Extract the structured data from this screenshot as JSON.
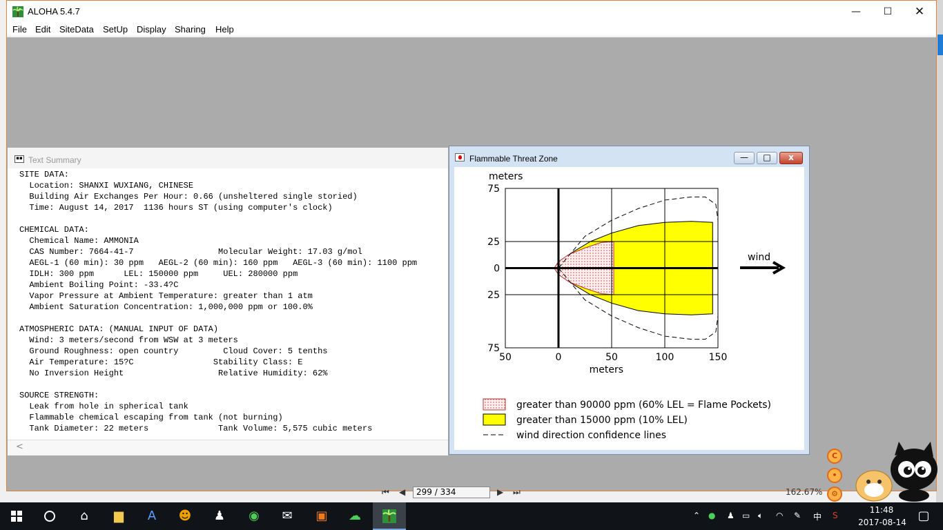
{
  "app": {
    "title": "ALOHA 5.4.7",
    "menu": [
      "File",
      "Edit",
      "SiteData",
      "SetUp",
      "Display",
      "Sharing",
      "Help"
    ]
  },
  "text_summary": {
    "title": "Text Summary",
    "lines": [
      "SITE DATA:",
      "  Location: SHANXI WUXIANG, CHINESE",
      "  Building Air Exchanges Per Hour: 0.66 (unsheltered single storied)",
      "  Time: August 14, 2017  1136 hours ST (using computer's clock)",
      "",
      "CHEMICAL DATA:",
      "  Chemical Name: AMMONIA",
      "  CAS Number: 7664-41-7                 Molecular Weight: 17.03 g/mol",
      "  AEGL-1 (60 min): 30 ppm   AEGL-2 (60 min): 160 ppm   AEGL-3 (60 min): 1100 ppm",
      "  IDLH: 300 ppm      LEL: 150000 ppm     UEL: 280000 ppm",
      "  Ambient Boiling Point: -33.4?C",
      "  Vapor Pressure at Ambient Temperature: greater than 1 atm",
      "  Ambient Saturation Concentration: 1,000,000 ppm or 100.0%",
      "",
      "ATMOSPHERIC DATA: (MANUAL INPUT OF DATA)",
      "  Wind: 3 meters/second from WSW at 3 meters",
      "  Ground Roughness: open country         Cloud Cover: 5 tenths",
      "  Air Temperature: 15?C                Stability Class: E",
      "  No Inversion Height                   Relative Humidity: 62%",
      "",
      "SOURCE STRENGTH:",
      "  Leak from hole in spherical tank",
      "  Flammable chemical escaping from tank (not burning)",
      "  Tank Diameter: 22 meters              Tank Volume: 5,575 cubic meters"
    ],
    "scroll_left_glyph": "<"
  },
  "threat_zone": {
    "title": "Flammable Threat Zone",
    "controls": {
      "minimize": "—",
      "restore": "□",
      "close": "x"
    }
  },
  "chart_data": {
    "type": "area",
    "ylabel": "meters",
    "xlabel": "meters",
    "xlim": [
      -50,
      150
    ],
    "ylim": [
      -75,
      75
    ],
    "x_tick_labels": [
      "50",
      "0",
      "50",
      "100",
      "150"
    ],
    "x_ticks": [
      -50,
      0,
      50,
      100,
      150
    ],
    "y_tick_labels": [
      "75",
      "25",
      "0",
      "25",
      "75"
    ],
    "y_ticks": [
      75,
      25,
      0,
      -25,
      -75
    ],
    "grid": true,
    "wind_label": "wind",
    "zones": [
      {
        "name": "greater than 90000 ppm (60% LEL = Flame Pockets)",
        "color": "#ffe0e0",
        "stroke": "#c43030",
        "pattern": "red-dots",
        "half_width": [
          [
            -4,
            0
          ],
          [
            0,
            6
          ],
          [
            10,
            13
          ],
          [
            25,
            19
          ],
          [
            40,
            24
          ],
          [
            52,
            25
          ]
        ],
        "x_end": 52
      },
      {
        "name": "greater than 15000 ppm (10% LEL)",
        "color": "#ffff00",
        "half_width": [
          [
            -4,
            0
          ],
          [
            0,
            6
          ],
          [
            15,
            16
          ],
          [
            30,
            25
          ],
          [
            50,
            33
          ],
          [
            75,
            40
          ],
          [
            100,
            43
          ],
          [
            125,
            44
          ],
          [
            145,
            43
          ]
        ],
        "x_end": 145
      },
      {
        "name": "wind direction confidence lines",
        "style": "dashed",
        "line": [
          [
            0,
            0
          ],
          [
            25,
            30
          ],
          [
            50,
            45
          ],
          [
            75,
            56
          ],
          [
            100,
            64
          ],
          [
            125,
            67
          ],
          [
            138,
            67
          ],
          [
            148,
            60
          ],
          [
            150,
            45
          ]
        ]
      }
    ]
  },
  "status": {
    "page": "299 / 334",
    "zoom": "162.67%"
  },
  "floating_icons": [
    "C",
    "•",
    "⚙"
  ],
  "taskbar": {
    "time": "11:48",
    "date": "2017-08-14",
    "ime": "中"
  }
}
